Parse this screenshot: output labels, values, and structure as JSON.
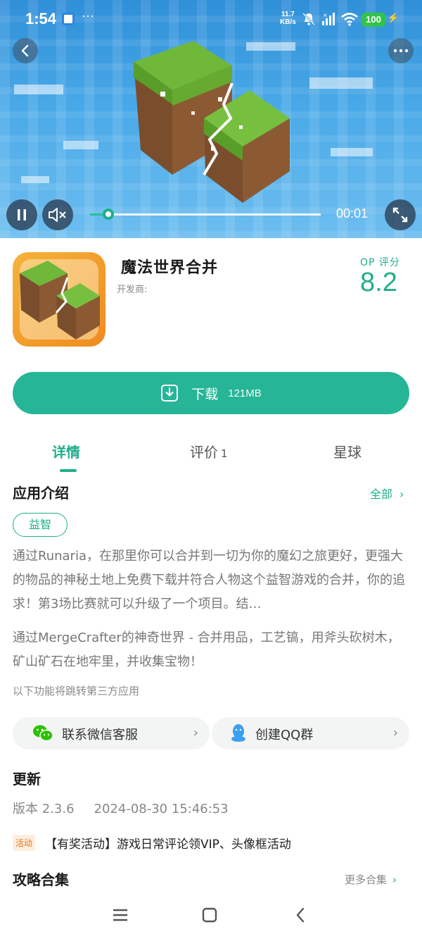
{
  "status_bar": {
    "time": "1:54",
    "more_dots": "···",
    "net_speed_value": "11.7",
    "net_speed_unit": "KB/s",
    "battery": "100"
  },
  "video": {
    "current_time": "00:01",
    "progress_fraction": 0.08
  },
  "app": {
    "name": "魔法世界合并",
    "developer": "开发商:",
    "score_label": "OP 评分",
    "score": "8.2"
  },
  "download": {
    "label": "下载",
    "size": "121MB"
  },
  "tabs": {
    "details": "详情",
    "review": "评价",
    "review_count": "1",
    "planet": "星球"
  },
  "intro": {
    "title": "应用介绍",
    "all_link": "全部",
    "tag": "益智",
    "description_1": "通过Runaria，在那里你可以合并到一切为你的魔幻之旅更好，更强大的物品的神秘土地上免费下载并符合人物这个益智游戏的合并，你的追求！第3场比赛就可以升级了一个项目。结…",
    "description_2": "通过MergeCrafter的神奇世界 - 合并用品，工艺镐，用斧头砍树木，矿山矿石在地牢里，并收集宝物！",
    "third_party_note": "以下功能将跳转第三方应用"
  },
  "contacts": {
    "wechat_label": "联系微信客服",
    "qq_label": "创建QQ群"
  },
  "update": {
    "title": "更新",
    "version": "版本 2.3.6",
    "date": "2024-08-30 15:46:53"
  },
  "activity": {
    "badge": "活动",
    "text": "【有奖活动】游戏日常评论领VIP、头像框活动"
  },
  "guides": {
    "title": "攻略合集",
    "more_link": "更多合集"
  },
  "colors": {
    "accent": "#26b597",
    "accent_text": "#1fae8a",
    "activity_badge": "#e8751a"
  }
}
